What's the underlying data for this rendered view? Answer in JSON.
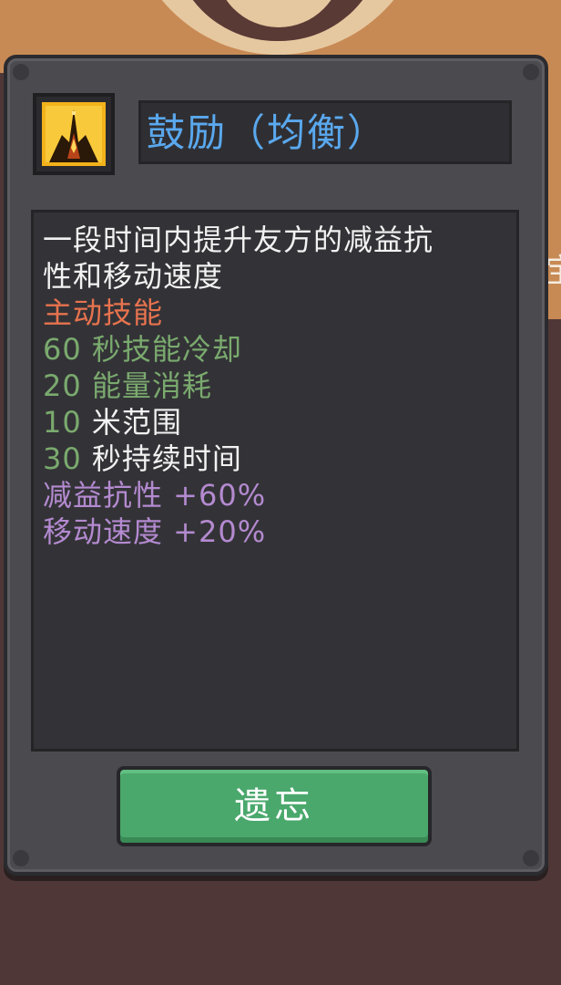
{
  "skill": {
    "name": "鼓励（均衡）",
    "icon": "encourage-flame-icon",
    "description": [
      "一段时间内提升友方的减益抗",
      "性和移动速度"
    ],
    "type_label": "主动技能",
    "cooldown": {
      "value": "60",
      "label": "秒技能冷却"
    },
    "energy": {
      "value": "20",
      "label": "能量消耗"
    },
    "range": {
      "value": "10",
      "label": "米范围"
    },
    "duration": {
      "value": "30",
      "label": "秒持续时间"
    },
    "stats": [
      "减益抗性 +60%",
      "移动速度 +20%"
    ]
  },
  "actions": {
    "forget_label": "遗忘"
  },
  "background": {
    "edge_text": "宝"
  },
  "colors": {
    "title": "#5aa8ee",
    "active_skill": "#e8734e",
    "stat_value": "#7aaa6e",
    "buff": "#b48ad0",
    "button": "#4aa86c"
  }
}
